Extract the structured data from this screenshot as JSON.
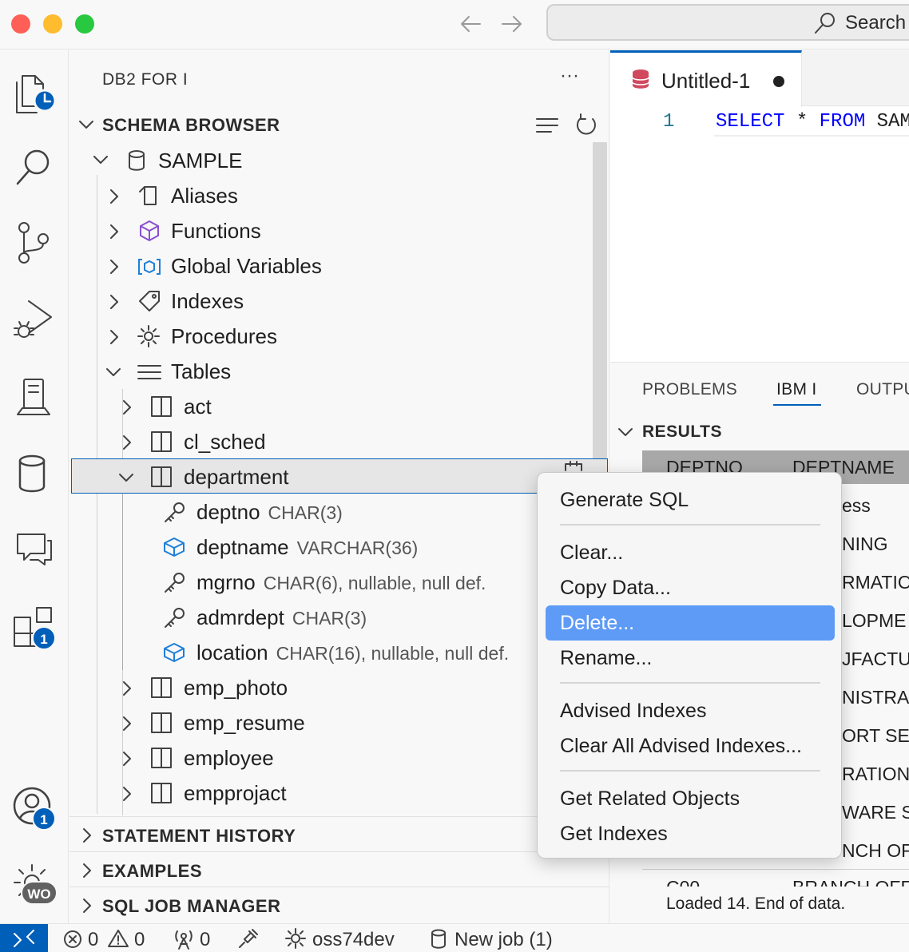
{
  "titlebar": {
    "search_placeholder": "Search"
  },
  "activity": {
    "extensions_badge": "1",
    "accounts_badge": "1",
    "manage_badge": "WO"
  },
  "sidebar": {
    "title": "DB2 FOR I",
    "more": "···",
    "schema_browser": "SCHEMA BROWSER",
    "schema": "SAMPLE",
    "categories": [
      "Aliases",
      "Functions",
      "Global Variables",
      "Indexes",
      "Procedures",
      "Tables"
    ],
    "tables": {
      "act": "act",
      "cl_sched": "cl_sched",
      "department": "department",
      "emp_photo": "emp_photo",
      "emp_resume": "emp_resume",
      "employee": "employee",
      "empprojact": "empprojact"
    },
    "columns": [
      {
        "name": "deptno",
        "type": "CHAR(3)"
      },
      {
        "name": "deptname",
        "type": "VARCHAR(36)"
      },
      {
        "name": "mgrno",
        "type": "CHAR(6), nullable, null def."
      },
      {
        "name": "admrdept",
        "type": "CHAR(3)"
      },
      {
        "name": "location",
        "type": "CHAR(16), nullable, null def."
      }
    ],
    "sections": [
      "STATEMENT HISTORY",
      "EXAMPLES",
      "SQL JOB MANAGER"
    ]
  },
  "editor": {
    "tab_title": "Untitled-1",
    "line_number": "1",
    "kw_select": "SELECT",
    "star": "*",
    "kw_from": "FROM",
    "rest": "SAM"
  },
  "panel": {
    "tabs": [
      "PROBLEMS",
      "IBM I",
      "OUTPU"
    ],
    "results_title": "RESULTS",
    "columns": [
      "DEPTNO",
      "DEPTNAME"
    ],
    "rows": [
      "ess",
      "NING",
      "RMATIO",
      "LOPME",
      "JFACTU",
      "NISTRA",
      "ORT SE",
      "RATIONS",
      "WARE S",
      "NCH OFF"
    ],
    "partial_row": [
      "C00",
      "BRANCH OFF"
    ],
    "status": "Loaded 14. End of data."
  },
  "context_menu": {
    "items": [
      "Generate SQL",
      "Clear...",
      "Copy Data...",
      "Delete...",
      "Rename...",
      "Advised Indexes",
      "Clear All Advised Indexes...",
      "Get Related Objects",
      "Get Indexes"
    ],
    "highlighted": "Delete..."
  },
  "statusbar": {
    "errors": "0",
    "warnings": "0",
    "ports": "0",
    "connection": "oss74dev",
    "job": "New job (1)"
  },
  "colors": {
    "accent": "#005fb8",
    "menu_highlight": "#5e9bf7",
    "keyword": "#0000ff",
    "db_icon": "#d1485f",
    "functions_icon": "#8a4fd1",
    "column_icon": "#1f7fd8"
  }
}
